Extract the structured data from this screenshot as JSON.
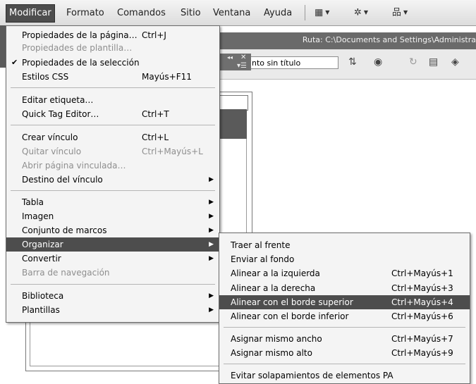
{
  "menubar": {
    "items": [
      "Modificar",
      "Formato",
      "Comandos",
      "Sitio",
      "Ventana",
      "Ayuda"
    ],
    "active": "Modificar",
    "toolbar_icons": [
      "layout-icon",
      "gear-icon",
      "site-icon"
    ]
  },
  "pathbar": {
    "text": "Ruta:  C:\\Documents and Settings\\Administra"
  },
  "document": {
    "title": "nto sin título"
  },
  "modify_menu": {
    "items": [
      {
        "label": "Propiedades de la página…",
        "shortcut": "Ctrl+J"
      },
      {
        "label": "Propiedades de plantilla…",
        "shortcut": "",
        "disabled": true
      },
      {
        "label": "Propiedades de la selección",
        "shortcut": "",
        "checked": true
      },
      {
        "label": "Estilos CSS",
        "shortcut": "Mayús+F11"
      },
      {
        "label": "Editar etiqueta…",
        "shortcut": ""
      },
      {
        "label": "Quick Tag Editor…",
        "shortcut": "Ctrl+T"
      },
      {
        "label": "Crear vínculo",
        "shortcut": "Ctrl+L"
      },
      {
        "label": "Quitar vínculo",
        "shortcut": "Ctrl+Mayús+L",
        "disabled": true
      },
      {
        "label": "Abrir página vinculada…",
        "shortcut": "",
        "disabled": true
      },
      {
        "label": "Destino del vínculo",
        "shortcut": "",
        "submenu": true
      },
      {
        "label": "Tabla",
        "shortcut": "",
        "submenu": true
      },
      {
        "label": "Imagen",
        "shortcut": "",
        "submenu": true
      },
      {
        "label": "Conjunto de marcos",
        "shortcut": "",
        "submenu": true
      },
      {
        "label": "Organizar",
        "shortcut": "",
        "submenu": true,
        "highlighted": true
      },
      {
        "label": "Convertir",
        "shortcut": "",
        "submenu": true
      },
      {
        "label": "Barra de navegación",
        "shortcut": "",
        "disabled": true
      },
      {
        "label": "Biblioteca",
        "shortcut": "",
        "submenu": true
      },
      {
        "label": "Plantillas",
        "shortcut": "",
        "submenu": true
      }
    ]
  },
  "arrange_menu": {
    "items": [
      {
        "label": "Traer al frente",
        "shortcut": ""
      },
      {
        "label": "Enviar al fondo",
        "shortcut": ""
      },
      {
        "label": "Alinear a la izquierda",
        "shortcut": "Ctrl+Mayús+1"
      },
      {
        "label": "Alinear a la derecha",
        "shortcut": "Ctrl+Mayús+3"
      },
      {
        "label": "Alinear con el borde superior",
        "shortcut": "Ctrl+Mayús+4",
        "highlighted": true
      },
      {
        "label": "Alinear con el borde inferior",
        "shortcut": "Ctrl+Mayús+6"
      },
      {
        "label": "Asignar mismo ancho",
        "shortcut": "Ctrl+Mayús+7"
      },
      {
        "label": "Asignar mismo alto",
        "shortcut": "Ctrl+Mayús+9"
      },
      {
        "label": "Evitar solapamientos de elementos PA",
        "shortcut": ""
      }
    ]
  },
  "colors": {
    "menu_bg": "#f4f4f4",
    "highlight": "#4d4d4d",
    "disabled": "#8e8e8e"
  }
}
